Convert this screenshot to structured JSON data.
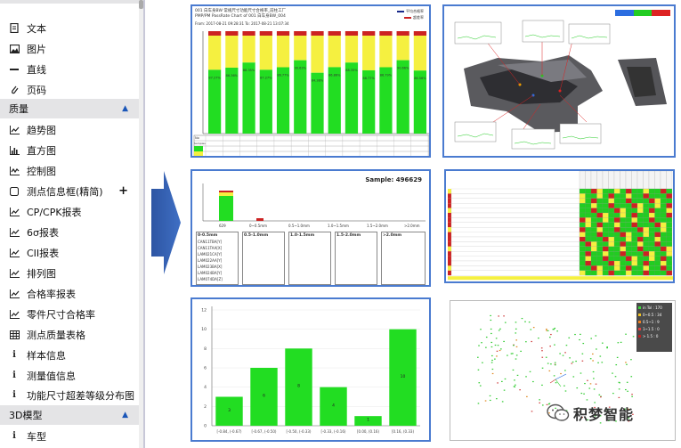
{
  "sidebar": {
    "top_items": [
      {
        "label": "文本",
        "icon": "document-icon"
      },
      {
        "label": "图片",
        "icon": "image-icon"
      },
      {
        "label": "直线",
        "icon": "line-icon"
      },
      {
        "label": "页码",
        "icon": "paperclip-icon"
      }
    ],
    "quality_section": {
      "label": "质量",
      "expanded": true
    },
    "quality_items": [
      {
        "label": "趋势图",
        "icon": "trend-chart-icon"
      },
      {
        "label": "直方图",
        "icon": "histogram-icon"
      },
      {
        "label": "控制图",
        "icon": "control-chart-icon"
      },
      {
        "label": "测点信息框(精简)",
        "icon": "box-icon",
        "addable": true
      },
      {
        "label": "CP/CPK报表",
        "icon": "trend-chart-icon"
      },
      {
        "label": "6σ报表",
        "icon": "trend-chart-icon"
      },
      {
        "label": "CII报表",
        "icon": "trend-chart-icon"
      },
      {
        "label": "排列图",
        "icon": "trend-chart-icon"
      },
      {
        "label": "合格率报表",
        "icon": "trend-chart-icon"
      },
      {
        "label": "零件尺寸合格率",
        "icon": "trend-chart-icon"
      },
      {
        "label": "测点质量表格",
        "icon": "table-icon"
      },
      {
        "label": "样本信息",
        "icon": "info-icon"
      },
      {
        "label": "测量值信息",
        "icon": "info-icon"
      },
      {
        "label": "功能尺寸超差等级分布图",
        "icon": "info-icon"
      }
    ],
    "model_section": {
      "label": "3D模型",
      "expanded": true
    },
    "model_items": [
      {
        "label": "车型",
        "icon": "info-icon"
      }
    ],
    "plus_symbol": "+"
  },
  "panels": {
    "passrate": {
      "title_line1": "001 白车身BW 常规尺寸功能尺寸合格率_前柱工厂",
      "title_line2": "PMP/PM PassRate Chart of 001 白车身BW_004",
      "date_line": "From: 2017-08-21 09:28:31    To: 2017-08-21 13:07:34",
      "legend": [
        "平均合格率",
        "超差率"
      ],
      "percentages": [
        "87.27%",
        "86.36%",
        "88.35%",
        "87.27%",
        "86.77%",
        "90.63%",
        "84.38%",
        "86.86%",
        "88.35%",
        "86.77%",
        "86.79%",
        "90.66%",
        "86.56%"
      ],
      "footer_labels": [
        "No",
        "Samples",
        "Total"
      ]
    },
    "pareto": {
      "sample_label": "Sample: 496629",
      "bin_labels": [
        "629",
        "0~0.5mm",
        "0.5~1.0mm",
        "1.0~1.5mm",
        "1.5~2.0mm",
        ">2.0mm"
      ],
      "box_headers": [
        "0-0.5mm",
        "0.5-1.0mm",
        "1.0-1.5mm",
        "1.5-2.0mm",
        ">2.0mm"
      ],
      "list_items": [
        "CAN11TBA[Y]",
        "CAN11TAA[X]",
        "LAM021CA[Y]",
        "LAM022AA[Y]",
        "LAM023BA[X]",
        "LAM024BA[Y]",
        "LAM074DA[Z]"
      ]
    },
    "floor": {
      "legend_items": [
        "in Tol : 170",
        "0~0.5 : 34",
        "0.5~1 : 9",
        "1~1.5 : 0",
        "> 1.5 : 0"
      ]
    }
  },
  "chart_data": {
    "type": "bar",
    "categories": [
      "[-0.84, (-0.67)",
      "[-0.67, (-0.50)",
      "[-0.50, (-0.33)",
      "[-0.33, (-0.16)",
      "[0.00, (0.16)",
      "[0.16, (0.33)"
    ],
    "values": [
      3,
      6,
      8,
      4,
      1,
      10
    ],
    "ylim": [
      0,
      12
    ],
    "yticks": [
      0,
      2,
      4,
      6,
      8,
      10,
      12
    ],
    "color": "#22dd22"
  },
  "watermark": {
    "text": "积梦智能"
  },
  "colors": {
    "accent": "#1a56b8",
    "panel_border": "#4a7bd0",
    "bar_green": "#22dd22",
    "bar_yellow": "#f5f040",
    "bar_red": "#cc2222"
  }
}
